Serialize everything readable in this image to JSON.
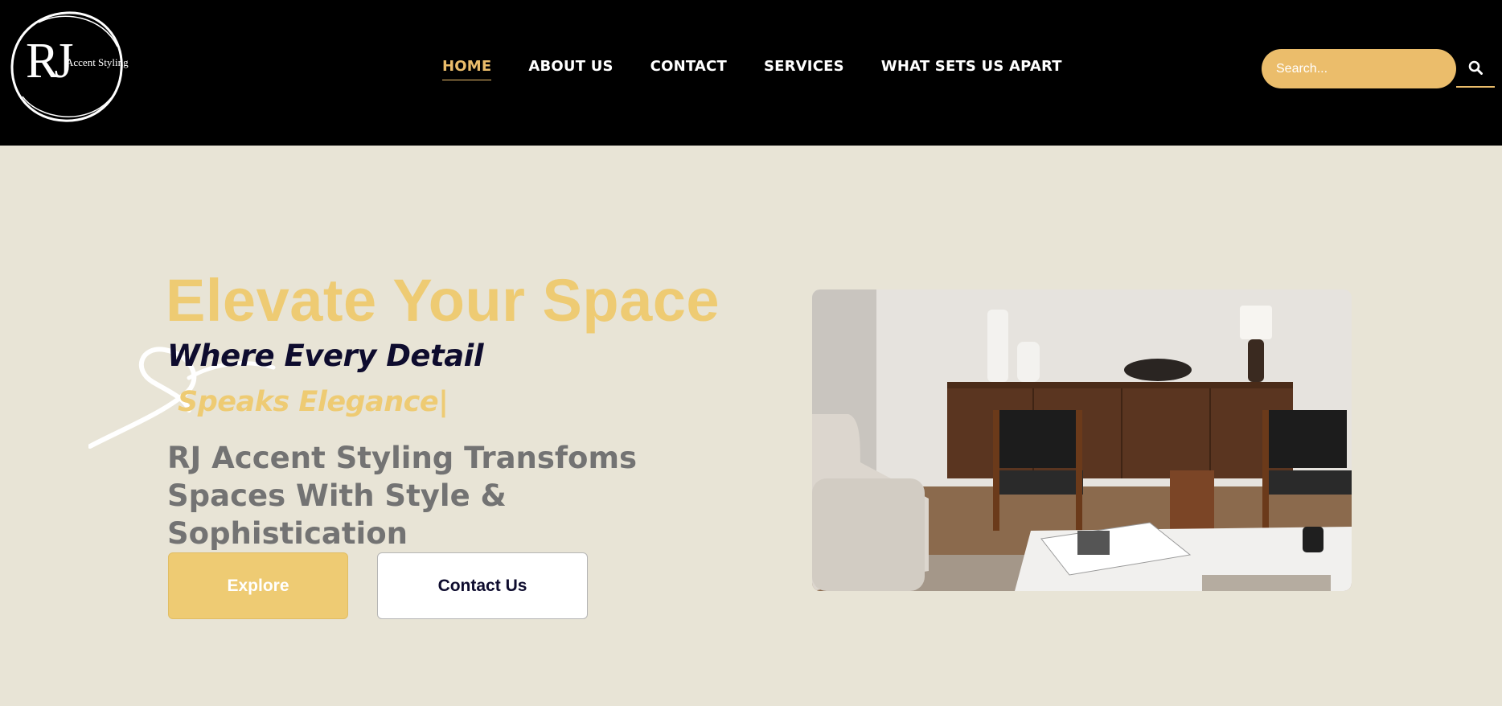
{
  "header": {
    "logo": {
      "monogram": "RJ",
      "text": "Accent Styling"
    },
    "nav": [
      {
        "label": "HOME",
        "active": true
      },
      {
        "label": "ABOUT US",
        "active": false
      },
      {
        "label": "CONTACT",
        "active": false
      },
      {
        "label": "SERVICES",
        "active": false
      },
      {
        "label": "WHAT SETS US APART",
        "active": false
      }
    ],
    "search": {
      "placeholder": "Search...",
      "icon": "search-icon"
    }
  },
  "hero": {
    "title": "Elevate Your Space",
    "tagline_line1": "Where Every Detail",
    "tagline_line2": "Speaks Elegance|",
    "subtitle": "RJ Accent Styling Transfoms Spaces With Style & Sophistication",
    "buttons": {
      "explore": "Explore",
      "contact": "Contact Us"
    },
    "image_icon": "living-room-photo"
  },
  "colors": {
    "header_bg": "#000000",
    "page_bg": "#e8e4d6",
    "accent": "#ebbd6b",
    "title_gold": "#eecb73",
    "dark_navy": "#0e0c2e",
    "subtitle_gray": "#737373"
  }
}
